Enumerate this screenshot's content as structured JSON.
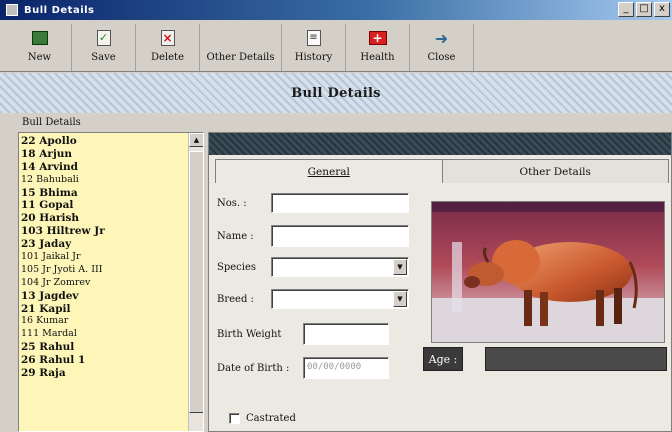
{
  "window": {
    "title": "Bull Details",
    "min": "_",
    "max": "□",
    "close": "x"
  },
  "toolbar": {
    "new": "New",
    "save": "Save",
    "delete": "Delete",
    "other_details": "Other Details",
    "history": "History",
    "health": "Health",
    "close": "Close"
  },
  "header": {
    "title": "Bull Details"
  },
  "bull_list": {
    "label": "Bull Details",
    "items": [
      "22 Apollo",
      "18 Arjun",
      "14 Arvind",
      "12 Bahubali",
      "15 Bhima",
      "11 Gopal",
      "20 Harish",
      "103 Hiltrew Jr",
      "23 Jaday",
      "101 Jaikal Jr",
      "105 Jr Jyoti A. III",
      "104 Jr Zomrev",
      "13 Jagdev",
      "21 Kapil",
      "16 Kumar",
      "111 Mardal",
      "25 Rahul",
      "26 Rahul 1",
      "29 Raja"
    ],
    "small_items": [
      3,
      9,
      10,
      11,
      14,
      15
    ]
  },
  "tabs": {
    "general": "General",
    "other": "Other Details"
  },
  "form": {
    "no_label": "Nos. :",
    "name_label": "Name :",
    "species_label": "Species",
    "breed_label": "Breed :",
    "birth_weight_label": "Birth Weight",
    "dob_label": "Date of Birth :",
    "dob_placeholder": "00/00/0000",
    "age_label": "Age :",
    "castrated_label": "Castrated"
  },
  "colors": {
    "list_bg": "#fdf6b8",
    "header_dark": "#2f3f4a",
    "band": "#c9d6e3"
  },
  "icons": [
    "new-icon",
    "save-icon",
    "delete-icon",
    "history-icon",
    "health-icon",
    "close-icon"
  ]
}
